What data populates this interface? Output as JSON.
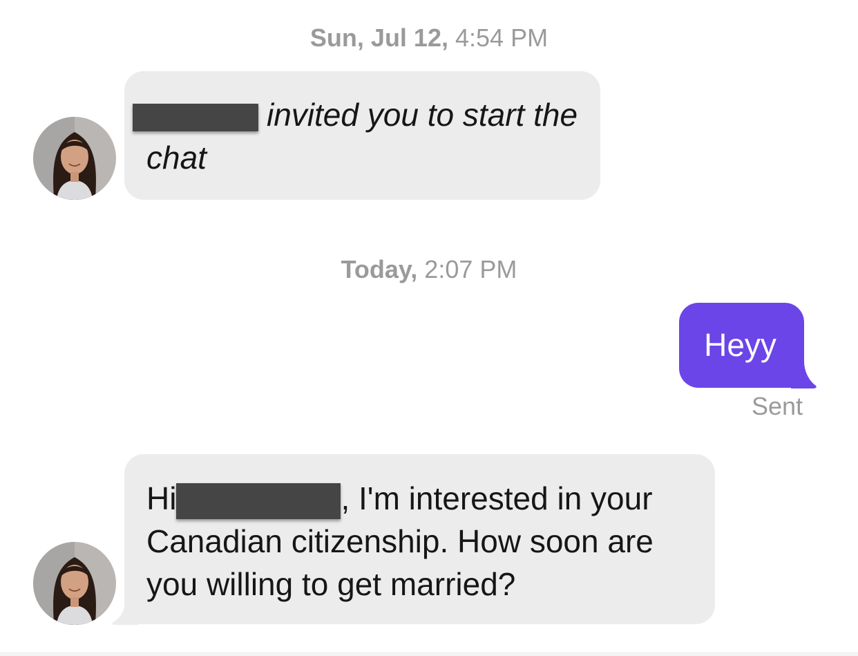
{
  "conversation": {
    "timestamps": [
      {
        "day": "Sun, Jul 12,",
        "time": "4:54 PM"
      },
      {
        "day": "Today,",
        "time": "2:07 PM"
      }
    ],
    "messages": [
      {
        "direction": "incoming",
        "style": "system-italic",
        "text_after_redaction": "invited you to start the chat"
      },
      {
        "direction": "outgoing",
        "text": "Heyy",
        "status": "Sent"
      },
      {
        "direction": "incoming",
        "text_before_redaction": "Hi",
        "text_after_redaction": ", I'm interested in your Canadian citizenship. How soon are you willing to get married?"
      }
    ]
  },
  "colors": {
    "outgoing_bubble": "#6b45e8",
    "incoming_bubble": "#ececec",
    "timestamp_text": "#9a9a9a",
    "redaction": "#454545"
  },
  "icons": {
    "avatar": "profile-photo-avatar"
  }
}
